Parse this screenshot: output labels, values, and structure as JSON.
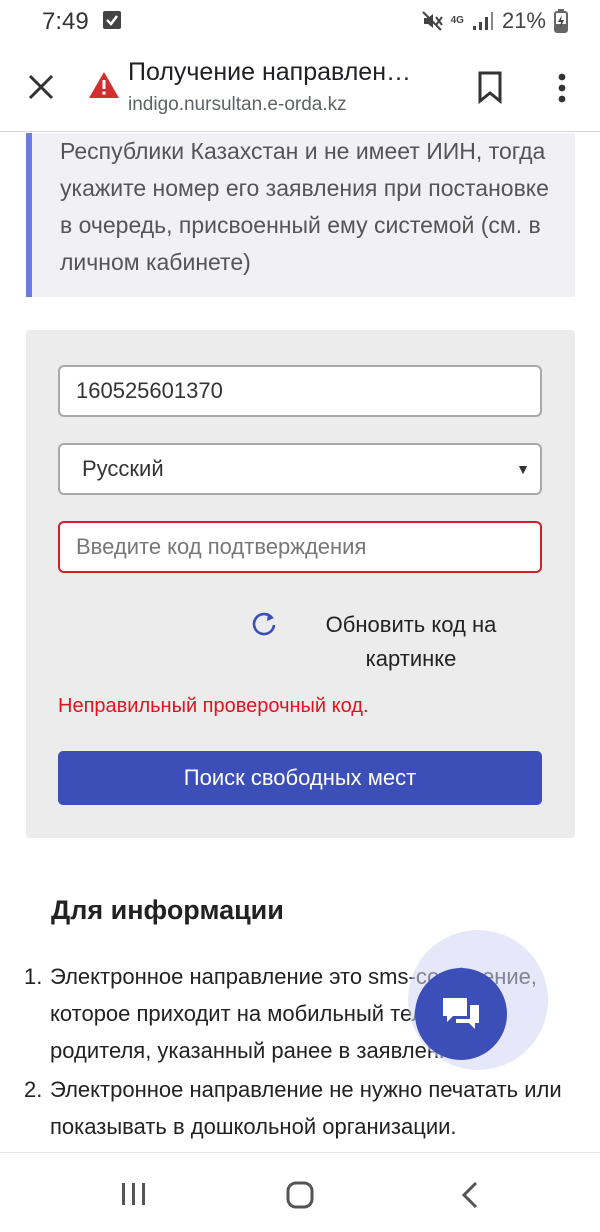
{
  "status_bar": {
    "time": "7:49",
    "network": "4G",
    "battery": "21%"
  },
  "browser": {
    "title": "Получение направлен…",
    "url": "indigo.nursultan.e-orda.kz",
    "warning_color": "#d32f2f"
  },
  "callout": {
    "text": "Республики Казахстан и не имеет ИИН, тогда укажите номер его заявления при постановке в очередь, присвоенный ему системой (см. в личном кабинете)"
  },
  "form": {
    "iin_value": "160525601370",
    "language_selected": "Русский",
    "captcha_placeholder": "Введите код подтверждения",
    "refresh_label": "Обновить код на картинке",
    "error_message": "Неправильный проверочный код.",
    "search_button": "Поиск свободных мест"
  },
  "info": {
    "heading": "Для информации",
    "items": [
      {
        "num": "1.",
        "text": "Электронное направление это sms-сообщение, которое приходит на мобильный телефон родителя, указанный ранее в заявлении"
      },
      {
        "num": "2.",
        "text": "Электронное направление не нужно печатать или показывать в дошкольной организации."
      }
    ]
  },
  "colors": {
    "accent": "#3c4fb8",
    "error": "#e0141e",
    "callout_border": "#6b7be0"
  }
}
